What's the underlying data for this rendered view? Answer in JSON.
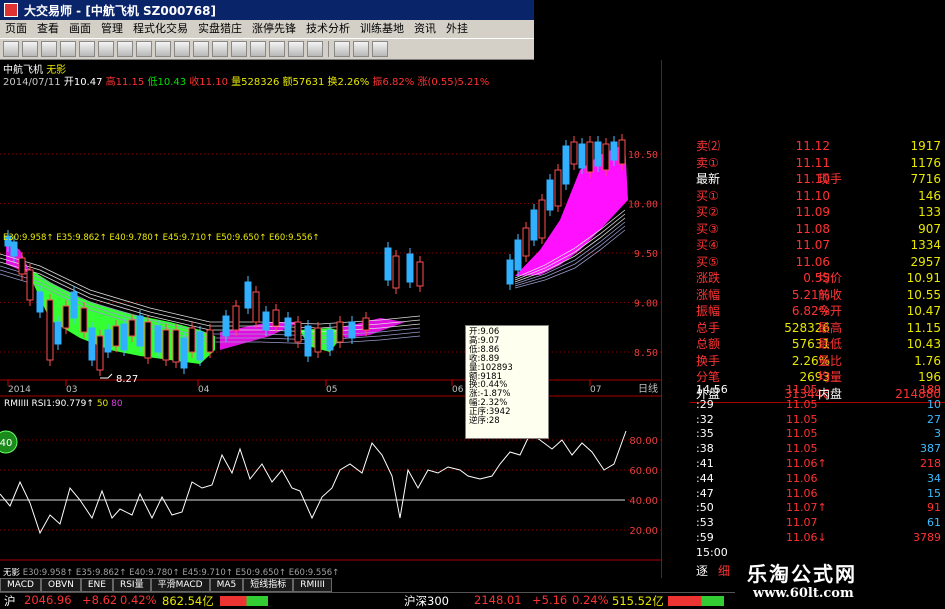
{
  "window": {
    "title": "大交易师 - [中航飞机 SZ000768]"
  },
  "menu": [
    "页面",
    "查看",
    "画面",
    "管理",
    "程式化交易",
    "实盘猎庄",
    "涨停先锋",
    "技术分析",
    "训练基地",
    "资讯",
    "外挂"
  ],
  "stock": {
    "name": "中航飞机",
    "ma_label": "无影"
  },
  "info_line": {
    "date": "2014/07/11",
    "open": "开10.47",
    "high": "高11.15",
    "low": "低10.43",
    "close": "收11.10",
    "volume": "量528326",
    "amount": "额57631",
    "turnover": "换2.26%",
    "amplitude": "振6.82%",
    "change": "涨(0.55)5.21%"
  },
  "ma_values": "E30:9.958↑ E35:9.862↑ E40:9.780↑ E45:9.710↑ E50:9.650↑ E60:9.556↑",
  "ma_values_bottom": "E30:9.958↑ E35:9.862↑ E40:9.780↑ E45:9.710↑ E50:9.650↑ E60:9.556↑",
  "indicator": {
    "label": "RMIIII",
    "rsi": "RSI1:90.779↑",
    "v1": "50",
    "v2": "80",
    "badge": "40"
  },
  "price_axis": [
    "10.50",
    "10.00",
    "9.50",
    "9.00",
    "8.50"
  ],
  "ind_axis": [
    "80.00",
    "60.00",
    "40.00",
    "20.00"
  ],
  "date_axis": [
    "2014",
    "03",
    "04",
    "05",
    "06",
    "07"
  ],
  "low_mark": "8.27",
  "period": "日线",
  "tooltip": [
    "开:9.06",
    "高:9.07",
    "低:8.86",
    "收:8.89",
    "量:102893",
    "额:9181",
    "换:0.44%",
    "涨:-1.87%",
    "幅:2.32%",
    "正序:3942",
    "逆序:28"
  ],
  "quote": {
    "rows": [
      {
        "label": "卖⑵",
        "price": "11.12",
        "vol": "1917"
      },
      {
        "label": "卖①",
        "price": "11.11",
        "vol": "1176"
      },
      {
        "label": "最新",
        "price": "11.10",
        "mid": "现手",
        "vol": "7716"
      },
      {
        "label": "买①",
        "price": "11.10",
        "vol": "146"
      },
      {
        "label": "买②",
        "price": "11.09",
        "vol": "133"
      },
      {
        "label": "买③",
        "price": "11.08",
        "vol": "907"
      },
      {
        "label": "买④",
        "price": "11.07",
        "vol": "1334"
      },
      {
        "label": "买⑤",
        "price": "11.06",
        "vol": "2957"
      },
      {
        "label": "涨跌",
        "price": "0.55",
        "mid": "均价",
        "vol": "10.91"
      },
      {
        "label": "涨幅",
        "price": "5.21%",
        "mid": "前收",
        "vol": "10.55"
      },
      {
        "label": "振幅",
        "price": "6.82%",
        "mid": "今开",
        "vol": "10.47"
      },
      {
        "label": "总手",
        "price": "528326",
        "mid": "最高",
        "vol": "11.15"
      },
      {
        "label": "总额",
        "price": "57631",
        "mid": "最低",
        "vol": "10.43"
      },
      {
        "label": "换手",
        "price": "2.26%",
        "mid": "量比",
        "vol": "1.76"
      },
      {
        "label": "分笔",
        "price": "2693",
        "mid": "均量",
        "vol": "196"
      },
      {
        "label": "外盘",
        "price": "313446",
        "mid": "内盘",
        "vol": "214880"
      }
    ],
    "ticks": [
      {
        "t": "14:56",
        "p": "11.05",
        "v": "189"
      },
      {
        "t": ":29",
        "p": "11.05",
        "v": "10"
      },
      {
        "t": ":32",
        "p": "11.05",
        "v": "27"
      },
      {
        "t": ":35",
        "p": "11.05",
        "v": "3"
      },
      {
        "t": ":38",
        "p": "11.05",
        "v": "387"
      },
      {
        "t": ":41",
        "p": "11.06↑",
        "v": "218"
      },
      {
        "t": ":44",
        "p": "11.06",
        "v": "34"
      },
      {
        "t": ":47",
        "p": "11.06",
        "v": "15"
      },
      {
        "t": ":50",
        "p": "11.07↑",
        "v": "91"
      },
      {
        "t": ":53",
        "p": "11.07",
        "v": "61"
      },
      {
        "t": ":59",
        "p": "11.06↓",
        "v": "3789"
      },
      {
        "t": "15:00",
        "p": "",
        "v": ""
      }
    ],
    "bottom_tabs": [
      "逐",
      "细"
    ]
  },
  "tabs": [
    "MACD",
    "OBVN",
    "ENE",
    "RSI量",
    "平滑MACD",
    "MA5",
    "短线指标",
    "RMIIII"
  ],
  "status": {
    "sh_label": "沪",
    "sh_index": "2046.96",
    "sh_change": "+8.62",
    "sh_pct": "0.42%",
    "sh_amount": "862.54亿",
    "hs_label": "沪深300",
    "hs_index": "2148.01",
    "hs_change": "+5.16",
    "hs_pct": "0.24%",
    "hs_amount": "515.52亿"
  },
  "watermark": {
    "cn": "乐淘公式网",
    "url": "www.60lt.com"
  }
}
